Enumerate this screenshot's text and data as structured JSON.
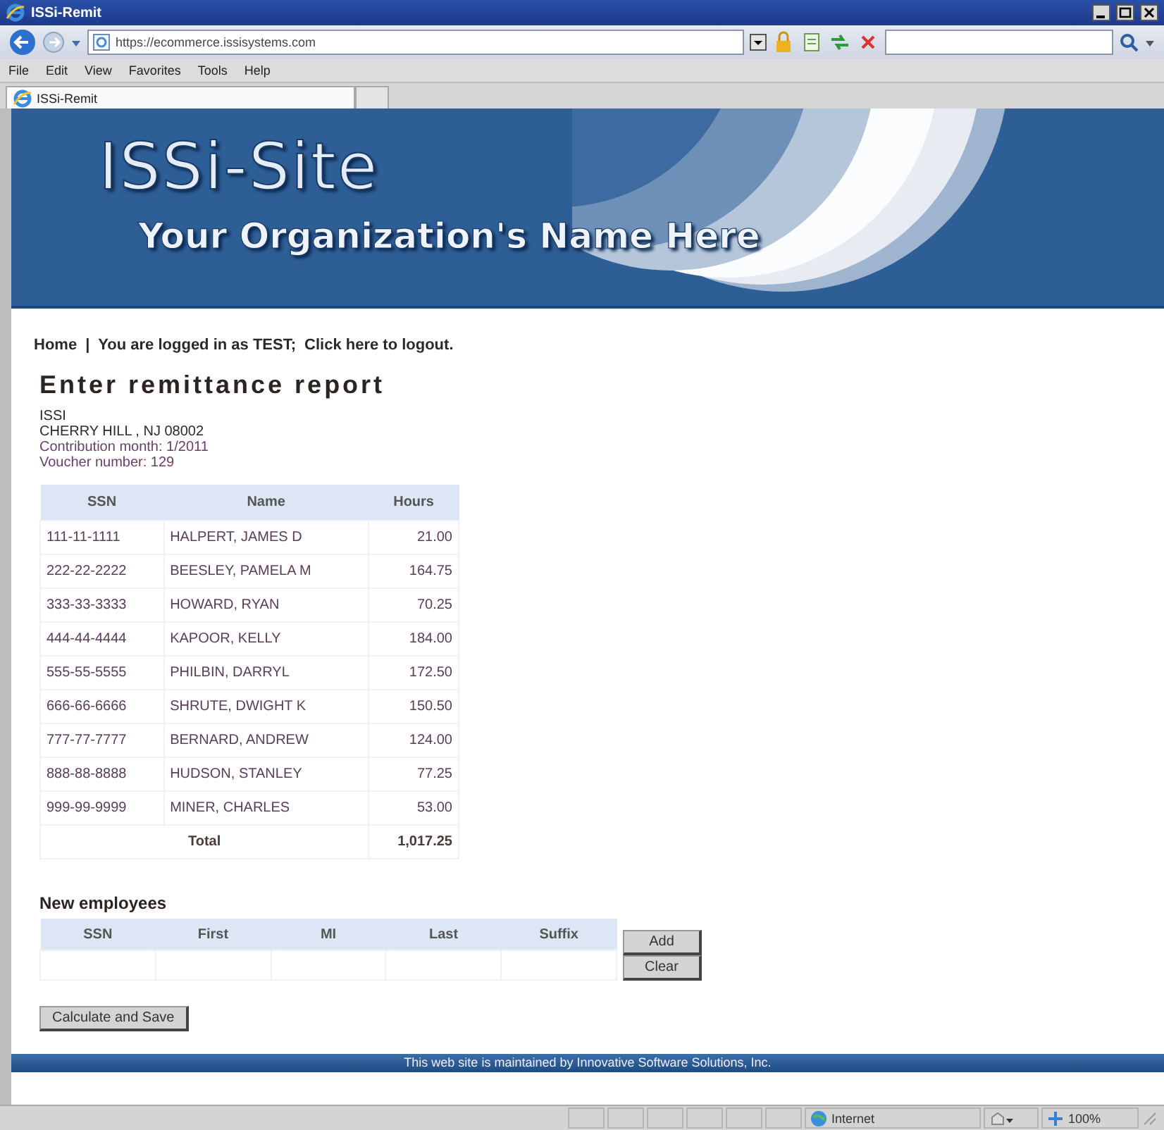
{
  "window": {
    "title": "ISSi-Remit"
  },
  "address_bar": {
    "url": "https://ecommerce.issisystems.com"
  },
  "menu": [
    "File",
    "Edit",
    "View",
    "Favorites",
    "Tools",
    "Help"
  ],
  "tabs": [
    {
      "label": "ISSi-Remit",
      "selected": true
    }
  ],
  "banner": {
    "title": "ISSi-Site",
    "subtitle": "Your Organization's Name Here"
  },
  "nav": {
    "home": "Home",
    "separator": "|",
    "logged_in": "You are logged in as TEST;",
    "logout": "Click here to logout."
  },
  "heading": "Enter remittance report",
  "details": [
    "ISSI",
    "CHERRY HILL , NJ 08002",
    "Contribution month: 1/2011",
    "Voucher number: 129"
  ],
  "remittance_table": {
    "columns": [
      "SSN",
      "Name",
      "Hours"
    ],
    "rows": [
      {
        "ssn": "111-11-1111",
        "name": "HALPERT, JAMES D",
        "hours": "21.00"
      },
      {
        "ssn": "222-22-2222",
        "name": "BEESLEY, PAMELA M",
        "hours": "164.75"
      },
      {
        "ssn": "333-33-3333",
        "name": "HOWARD, RYAN",
        "hours": "70.25"
      },
      {
        "ssn": "444-44-4444",
        "name": "KAPOOR, KELLY",
        "hours": "184.00"
      },
      {
        "ssn": "555-55-5555",
        "name": "PHILBIN, DARRYL",
        "hours": "172.50"
      },
      {
        "ssn": "666-66-6666",
        "name": "SHRUTE, DWIGHT K",
        "hours": "150.50"
      },
      {
        "ssn": "777-77-7777",
        "name": "BERNARD, ANDREW",
        "hours": "124.00"
      },
      {
        "ssn": "888-88-8888",
        "name": "HUDSON, STANLEY",
        "hours": "77.25"
      },
      {
        "ssn": "999-99-9999",
        "name": "MINER, CHARLES",
        "hours": "53.00"
      }
    ],
    "total": {
      "label": "Total",
      "value": "1,017.25"
    }
  },
  "new_employees": {
    "title": "New employees",
    "columns": [
      "SSN",
      "First",
      "MI",
      "Last",
      "Suffix"
    ],
    "buttons": [
      "Add",
      "Clear"
    ]
  },
  "calculate_button": "Calculate and Save",
  "footer": "This web site is maintained by Innovative Software Solutions, Inc.",
  "status_bar": {
    "zone": "Internet",
    "zoom": "100%"
  }
}
